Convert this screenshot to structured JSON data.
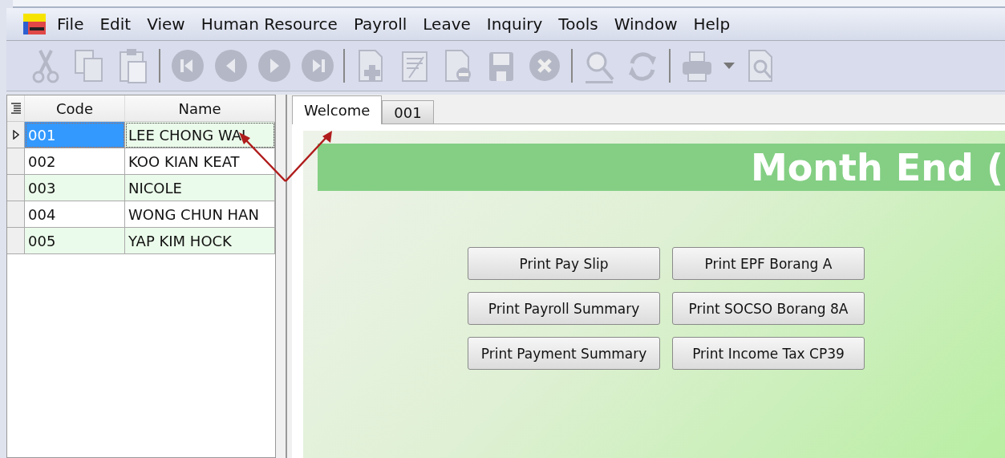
{
  "menu": [
    "File",
    "Edit",
    "View",
    "Human Resource",
    "Payroll",
    "Leave",
    "Inquiry",
    "Tools",
    "Window",
    "Help"
  ],
  "toolbar": [
    {
      "kind": "cut"
    },
    {
      "kind": "copy"
    },
    {
      "kind": "paste"
    },
    {
      "kind": "sep"
    },
    {
      "kind": "first"
    },
    {
      "kind": "prev"
    },
    {
      "kind": "next"
    },
    {
      "kind": "last"
    },
    {
      "kind": "sep"
    },
    {
      "kind": "new"
    },
    {
      "kind": "edit"
    },
    {
      "kind": "delete"
    },
    {
      "kind": "save"
    },
    {
      "kind": "cancel"
    },
    {
      "kind": "sep"
    },
    {
      "kind": "find"
    },
    {
      "kind": "refresh"
    },
    {
      "kind": "sep"
    },
    {
      "kind": "print"
    },
    {
      "kind": "dropdown"
    },
    {
      "kind": "preview"
    }
  ],
  "grid": {
    "columns": [
      "Code",
      "Name"
    ],
    "rows": [
      {
        "code": "001",
        "name": "LEE CHONG WAI",
        "selected": true
      },
      {
        "code": "002",
        "name": "KOO KIAN KEAT",
        "selected": false
      },
      {
        "code": "003",
        "name": "NICOLE",
        "selected": false
      },
      {
        "code": "004",
        "name": "WONG CHUN HAN",
        "selected": false
      },
      {
        "code": "005",
        "name": "YAP KIM HOCK",
        "selected": false
      }
    ]
  },
  "tabs": [
    {
      "label": "Welcome",
      "selected": true
    },
    {
      "label": "001",
      "selected": false
    }
  ],
  "banner": "Month End (",
  "buttons": [
    "Print Pay Slip",
    "Print EPF Borang A",
    "Print Payroll Summary",
    "Print SOCSO Borang 8A",
    "Print Payment Summary",
    "Print Income Tax CP39"
  ]
}
